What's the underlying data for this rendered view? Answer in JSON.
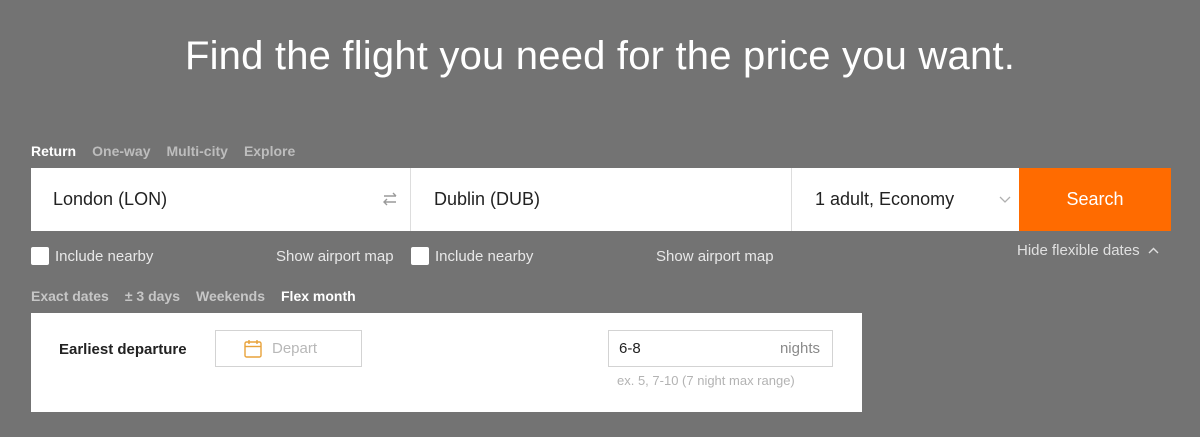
{
  "headline": "Find the flight you need for the price you want.",
  "trip_tabs": [
    {
      "label": "Return",
      "active": true
    },
    {
      "label": "One-way",
      "active": false
    },
    {
      "label": "Multi-city",
      "active": false
    },
    {
      "label": "Explore",
      "active": false
    }
  ],
  "search": {
    "origin": "London (LON)",
    "destination": "Dublin (DUB)",
    "passengers": "1 adult, Economy",
    "button": "Search"
  },
  "options": {
    "include_nearby": "Include nearby",
    "show_airport_map": "Show airport map",
    "hide_flexible_dates": "Hide flexible dates"
  },
  "date_tabs": [
    {
      "label": "Exact dates",
      "active": false
    },
    {
      "label": "± 3 days",
      "active": false
    },
    {
      "label": "Weekends",
      "active": false
    },
    {
      "label": "Flex month",
      "active": true
    }
  ],
  "flex": {
    "earliest_label": "Earliest departure",
    "depart_placeholder": "Depart",
    "nights_value": "6-8",
    "nights_unit": "nights",
    "nights_hint": "ex. 5, 7-10 (7 night max range)"
  },
  "colors": {
    "background": "#737373",
    "accent": "#ff6b00",
    "calendar_icon": "#e8a23a"
  }
}
